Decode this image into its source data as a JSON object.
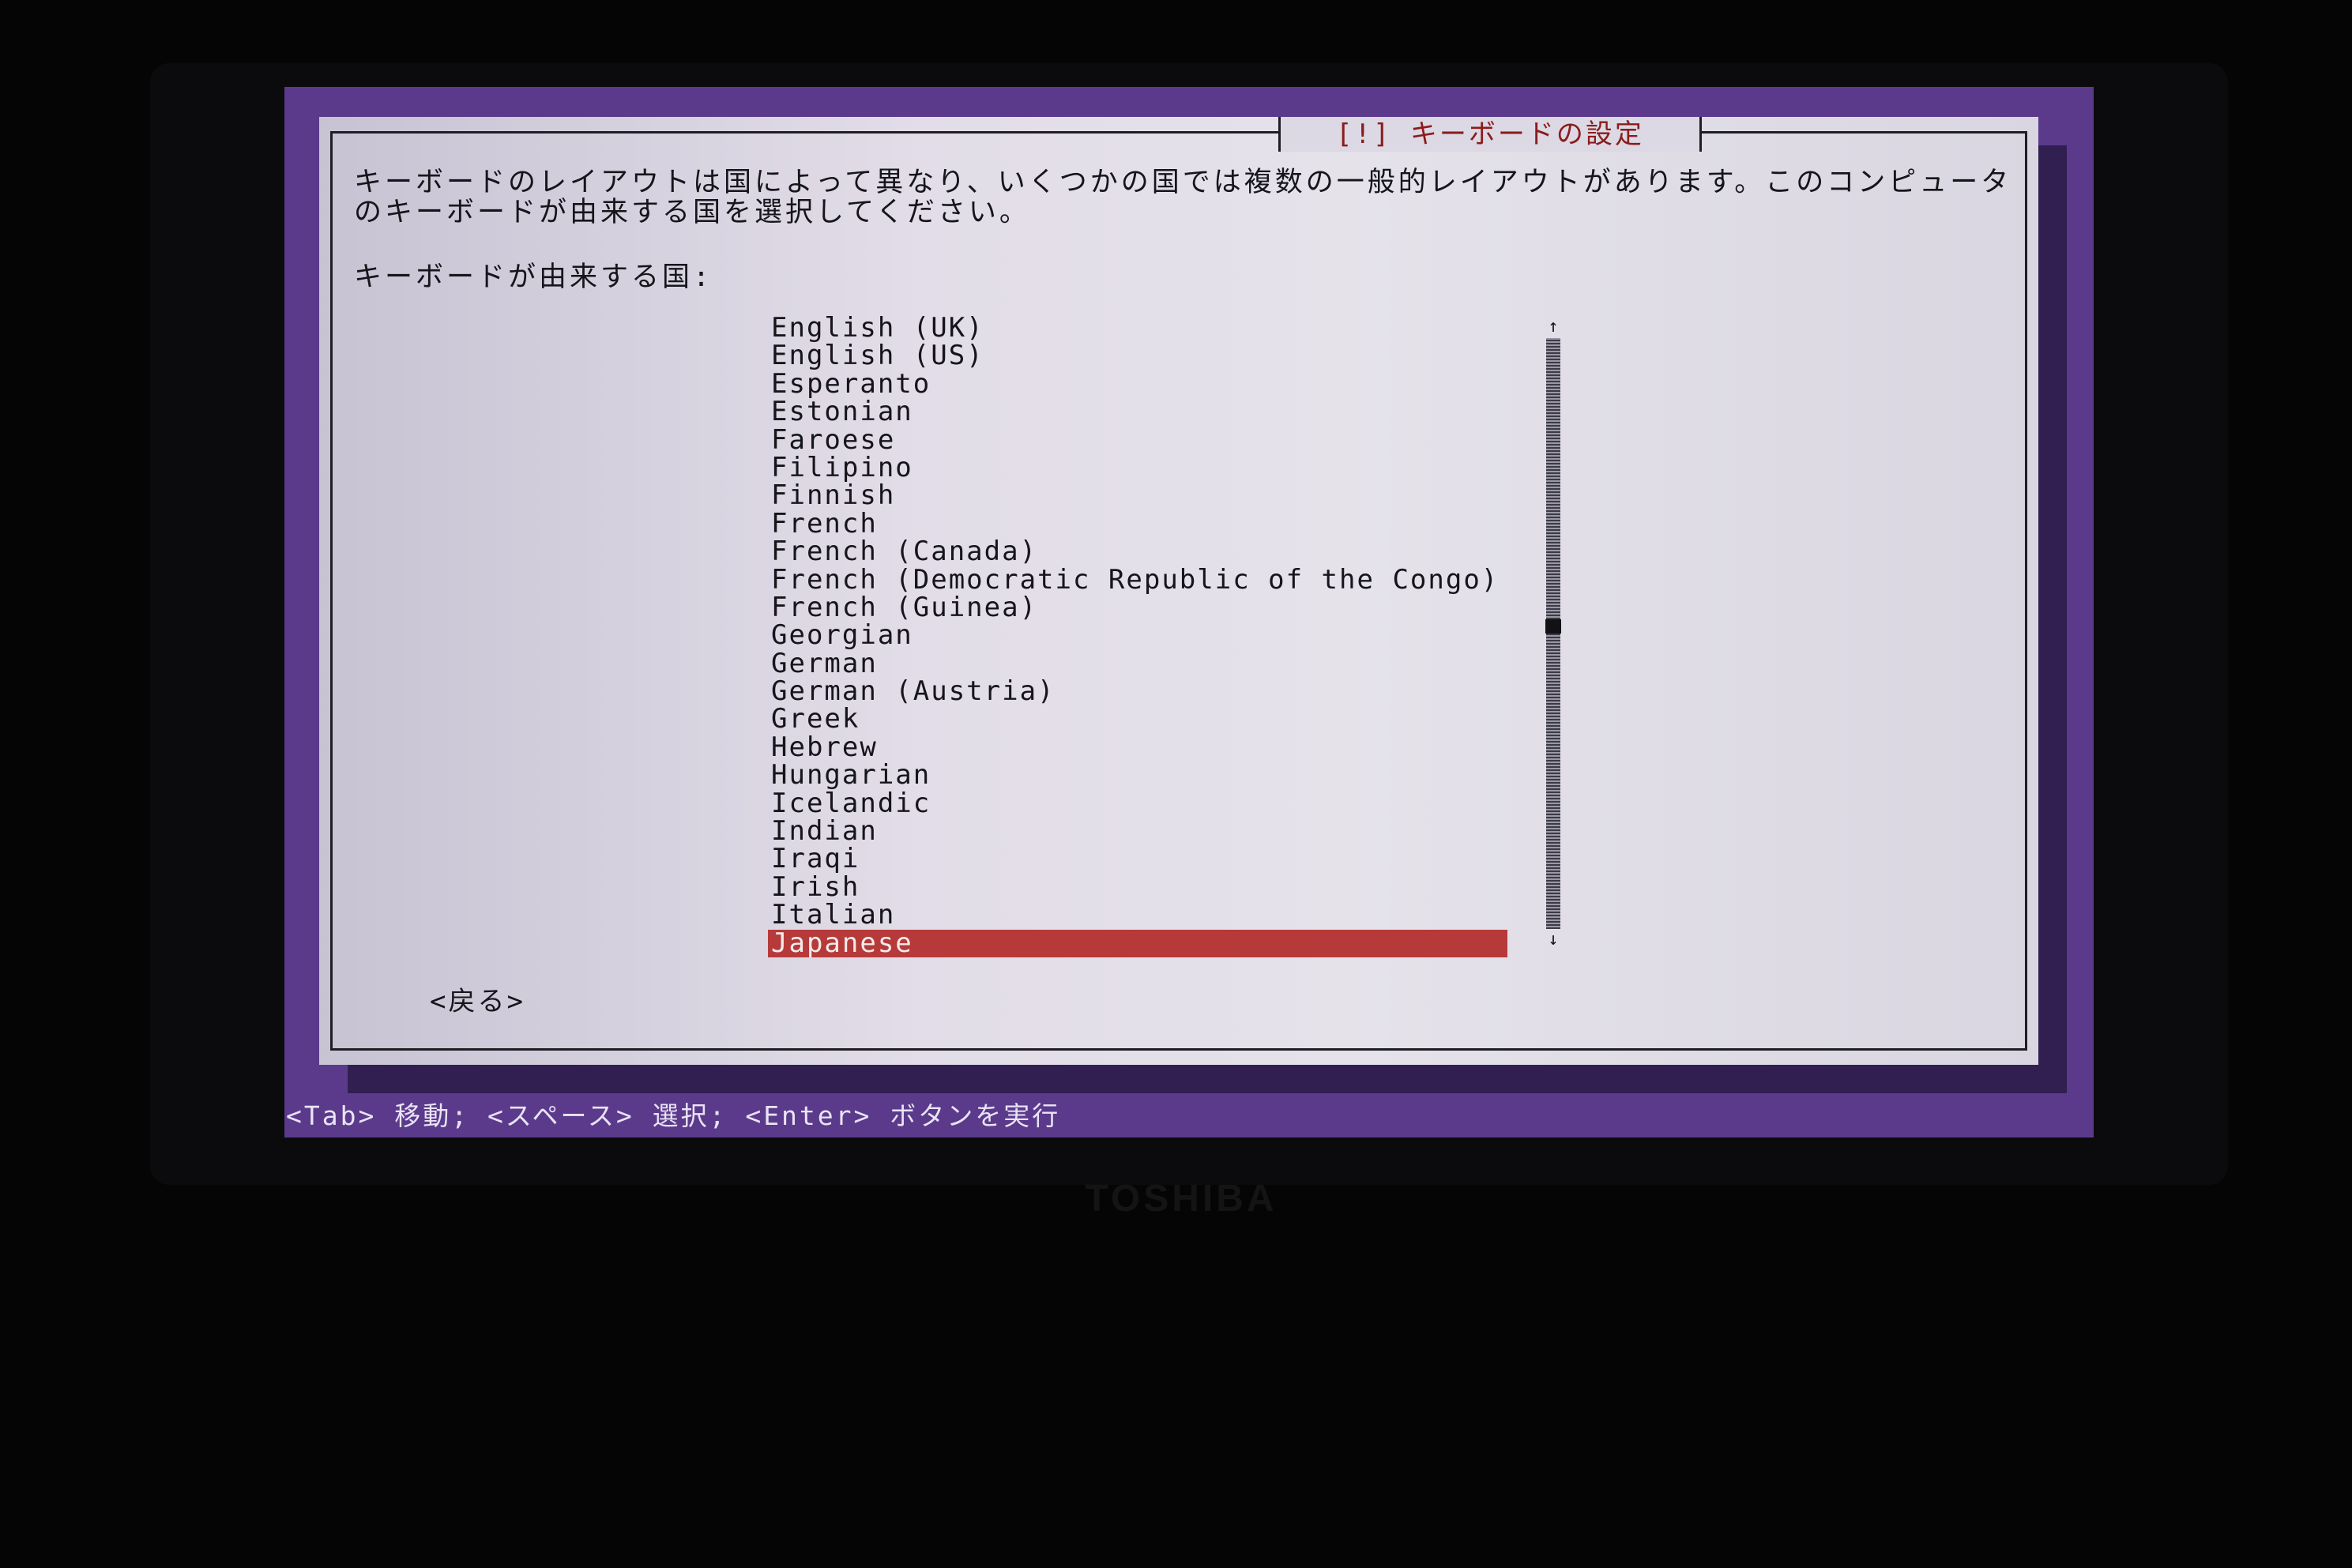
{
  "dialog": {
    "title": "[!] キーボードの設定",
    "description": "キーボードのレイアウトは国によって異なり、いくつかの国では複数の一般的レイアウトがあります。このコンピュータのキーボードが由来する国を選択してください。",
    "list_label": "キーボードが由来する国:",
    "back_label": "<戻る>"
  },
  "countries": [
    "English (UK)",
    "English (US)",
    "Esperanto",
    "Estonian",
    "Faroese",
    "Filipino",
    "Finnish",
    "French",
    "French (Canada)",
    "French (Democratic Republic of the Congo)",
    "French (Guinea)",
    "Georgian",
    "German",
    "German (Austria)",
    "Greek",
    "Hebrew",
    "Hungarian",
    "Icelandic",
    "Indian",
    "Iraqi",
    "Irish",
    "Italian",
    "Japanese"
  ],
  "selected_country": "Japanese",
  "scrollbar": {
    "up_icon": "↑",
    "down_icon": "↓"
  },
  "help_bar": "<Tab> 移動; <スペース> 選択; <Enter> ボタンを実行",
  "brand": "TOSHIBA",
  "colors": {
    "selection": "#b63a3a",
    "title_text": "#8a1c1c",
    "background": "#5b3a8c"
  }
}
